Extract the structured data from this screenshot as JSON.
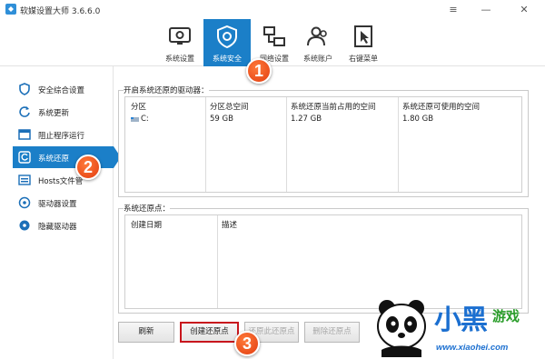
{
  "window": {
    "title": "软媒设置大师 3.6.6.0",
    "controls": [
      "≡",
      "—",
      "✕"
    ]
  },
  "toolbar": {
    "tabs": [
      {
        "label": "系统设置",
        "icon": "monitor-gear-icon",
        "active": false
      },
      {
        "label": "系统安全",
        "icon": "shield-gear-icon",
        "active": true
      },
      {
        "label": "网络设置",
        "icon": "network-icon",
        "active": false
      },
      {
        "label": "系统账户",
        "icon": "users-icon",
        "active": false
      },
      {
        "label": "右键菜单",
        "icon": "cursor-icon",
        "active": false
      }
    ]
  },
  "sidebar": {
    "items": [
      {
        "label": "安全综合设置",
        "icon": "shield-icon",
        "active": false
      },
      {
        "label": "系统更新",
        "icon": "refresh-icon",
        "active": false
      },
      {
        "label": "阻止程序运行",
        "icon": "window-block-icon",
        "active": false
      },
      {
        "label": "系统还原",
        "icon": "restore-icon",
        "active": true
      },
      {
        "label": "Hosts文件管",
        "icon": "hosts-icon",
        "active": false
      },
      {
        "label": "驱动器设置",
        "icon": "drive-icon",
        "active": false
      },
      {
        "label": "隐藏驱动器",
        "icon": "hidden-drive-icon",
        "active": false
      }
    ]
  },
  "drives_panel": {
    "title": "开启系统还原的驱动器：",
    "columns": [
      "分区",
      "分区总空间",
      "系统还原当前占用的空间",
      "系统还原可使用的空间"
    ],
    "rows": [
      {
        "partition": "C:",
        "total": "59 GB",
        "used": "1.27 GB",
        "available": "1.80 GB",
        "icon": "drive-icon"
      }
    ]
  },
  "restore_points_panel": {
    "title": "系统还原点：",
    "columns": [
      "创建日期",
      "描述"
    ],
    "rows": []
  },
  "buttons": {
    "refresh": "刷新",
    "create": "创建还原点",
    "restore": "还原此还原点",
    "delete": "删除还原点"
  },
  "markers": [
    "1",
    "2",
    "3"
  ],
  "watermark": {
    "brand": "小黑",
    "brand2": "游戏",
    "url": "www.xiaohei.com"
  },
  "colors": {
    "accent": "#1b7fc8",
    "marker": "#e8491a",
    "highlight_border": "#c8161d"
  }
}
